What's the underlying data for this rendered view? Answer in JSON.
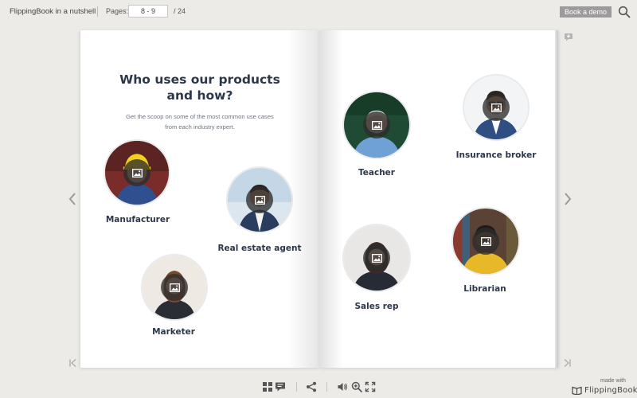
{
  "header": {
    "title": "FlippingBook in a nutshell",
    "pages_label": "Pages:",
    "pages_value": "8 - 9",
    "pages_total": "/  24",
    "demo_button": "Book a demo"
  },
  "left_page": {
    "heading_line1": "Who uses our products",
    "heading_line2": "and how?",
    "sub_line1": "Get the scoop on some of the most common use cases",
    "sub_line2": "from each industry expert.",
    "people": [
      {
        "label": "Manufacturer"
      },
      {
        "label": "Real estate agent"
      },
      {
        "label": "Marketer"
      }
    ]
  },
  "right_page": {
    "people": [
      {
        "label": "Teacher"
      },
      {
        "label": "Insurance broker"
      },
      {
        "label": "Sales rep"
      },
      {
        "label": "Librarian"
      }
    ]
  },
  "footer": {
    "made_with": "made with",
    "brand": "FlippingBook"
  },
  "colors": {
    "background": "#ecebe8",
    "heading": "#2c3749",
    "demo_button": "#9b9b9b",
    "overlay": "#2d2d2d"
  }
}
